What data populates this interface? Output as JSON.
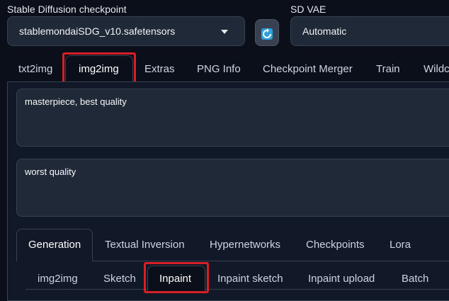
{
  "header": {
    "checkpoint_label": "Stable Diffusion checkpoint",
    "checkpoint_value": "stablemondaiSDG_v10.safetensors",
    "vae_label": "SD VAE",
    "vae_value": "Automatic",
    "refresh_icon": "refresh-icon",
    "accent_color": "#2fa0d9"
  },
  "main_tabs": [
    {
      "label": "txt2img"
    },
    {
      "label": "img2img",
      "active": true
    },
    {
      "label": "Extras"
    },
    {
      "label": "PNG Info"
    },
    {
      "label": "Checkpoint Merger"
    },
    {
      "label": "Train"
    },
    {
      "label": "Wildc"
    }
  ],
  "prompts": {
    "positive": "masterpiece, best quality",
    "negative": "worst quality"
  },
  "sub_tabs": [
    {
      "label": "Generation",
      "active": true
    },
    {
      "label": "Textual Inversion"
    },
    {
      "label": "Hypernetworks"
    },
    {
      "label": "Checkpoints"
    },
    {
      "label": "Lora"
    }
  ],
  "mode_tabs": [
    {
      "label": "img2img"
    },
    {
      "label": "Sketch"
    },
    {
      "label": "Inpaint",
      "active": true
    },
    {
      "label": "Inpaint sketch"
    },
    {
      "label": "Inpaint upload"
    },
    {
      "label": "Batch"
    }
  ],
  "highlight_color": "#d91f26"
}
